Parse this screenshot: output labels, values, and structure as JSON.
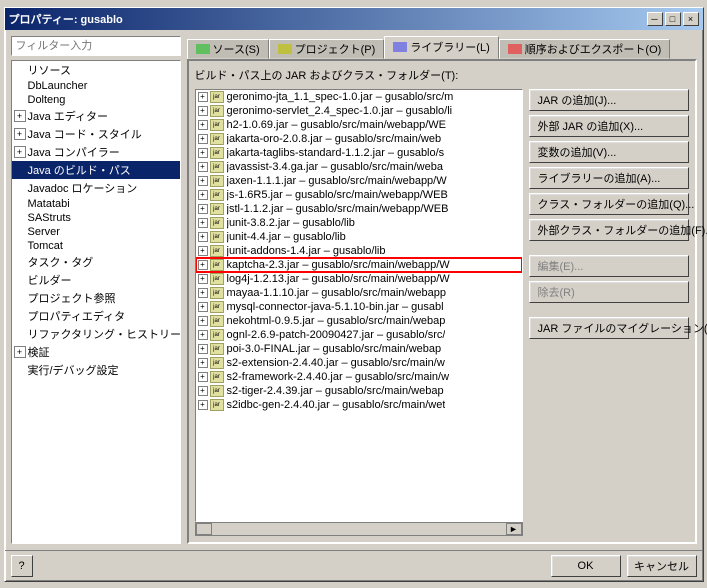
{
  "dialog": {
    "title": "プロパティー: gusablo",
    "close_btn": "×",
    "min_btn": "─",
    "max_btn": "□"
  },
  "left_panel": {
    "filter_placeholder": "フィルター入力",
    "tree_items": [
      {
        "id": "resources",
        "label": "リソース",
        "indent": 0,
        "expandable": false,
        "selected": false
      },
      {
        "id": "dblauncher",
        "label": "DbLauncher",
        "indent": 0,
        "expandable": false,
        "selected": false
      },
      {
        "id": "dolteng",
        "label": "Dolteng",
        "indent": 0,
        "expandable": false,
        "selected": false
      },
      {
        "id": "java-editor",
        "label": "Java エディター",
        "indent": 0,
        "expandable": true,
        "selected": false
      },
      {
        "id": "java-code-style",
        "label": "Java コード・スタイル",
        "indent": 0,
        "expandable": true,
        "selected": false
      },
      {
        "id": "java-compiler",
        "label": "Java コンパイラー",
        "indent": 0,
        "expandable": true,
        "selected": false
      },
      {
        "id": "java-build-path",
        "label": "Java のビルド・パス",
        "indent": 0,
        "expandable": false,
        "selected": true
      },
      {
        "id": "javadoc",
        "label": "Javadoc ロケーション",
        "indent": 0,
        "expandable": false,
        "selected": false
      },
      {
        "id": "matatabi",
        "label": "Matatabi",
        "indent": 0,
        "expandable": false,
        "selected": false
      },
      {
        "id": "sastruts",
        "label": "SAStruts",
        "indent": 0,
        "expandable": false,
        "selected": false
      },
      {
        "id": "server",
        "label": "Server",
        "indent": 0,
        "expandable": false,
        "selected": false
      },
      {
        "id": "tomcat",
        "label": "Tomcat",
        "indent": 0,
        "expandable": false,
        "selected": false
      },
      {
        "id": "task-tag",
        "label": "タスク・タグ",
        "indent": 0,
        "expandable": false,
        "selected": false
      },
      {
        "id": "builder",
        "label": "ビルダー",
        "indent": 0,
        "expandable": false,
        "selected": false
      },
      {
        "id": "project-ref",
        "label": "プロジェクト参照",
        "indent": 0,
        "expandable": false,
        "selected": false
      },
      {
        "id": "property-editor",
        "label": "プロパティエディタ",
        "indent": 0,
        "expandable": false,
        "selected": false
      },
      {
        "id": "refactoring",
        "label": "リファクタリング・ヒストリー",
        "indent": 0,
        "expandable": false,
        "selected": false
      },
      {
        "id": "test",
        "label": "検証",
        "indent": 0,
        "expandable": true,
        "selected": false
      },
      {
        "id": "run-debug",
        "label": "実行/デバッグ設定",
        "indent": 0,
        "expandable": false,
        "selected": false
      }
    ]
  },
  "tabs": [
    {
      "id": "source",
      "label": "ソース(S)",
      "active": false
    },
    {
      "id": "project",
      "label": "プロジェクト(P)",
      "active": false
    },
    {
      "id": "libraries",
      "label": "ライブラリー(L)",
      "active": true
    },
    {
      "id": "order",
      "label": "順序およびエクスポート(O)",
      "active": false
    }
  ],
  "main": {
    "panel_label": "ビルド・パス上の JAR およびクラス・フォルダー(T):",
    "jar_items": [
      {
        "id": "jar1",
        "label": "geronimo-jta_1.1_spec-1.0.jar – gusablo/src/m",
        "highlighted": false
      },
      {
        "id": "jar2",
        "label": "geronimo-servlet_2.4_spec-1.0.jar – gusablo/li",
        "highlighted": false
      },
      {
        "id": "jar3",
        "label": "h2-1.0.69.jar – gusablo/src/main/webapp/WE",
        "highlighted": false
      },
      {
        "id": "jar4",
        "label": "jakarta-oro-2.0.8.jar – gusablo/src/main/web",
        "highlighted": false
      },
      {
        "id": "jar5",
        "label": "jakarta-taglibs-standard-1.1.2.jar – gusablo/s",
        "highlighted": false
      },
      {
        "id": "jar6",
        "label": "javassist-3.4.ga.jar – gusablo/src/main/weba",
        "highlighted": false
      },
      {
        "id": "jar7",
        "label": "jaxen-1.1.1.jar – gusablo/src/main/webapp/W",
        "highlighted": false
      },
      {
        "id": "jar8",
        "label": "js-1.6R5.jar – gusablo/src/main/webapp/WEB",
        "highlighted": false
      },
      {
        "id": "jar9",
        "label": "jstl-1.1.2.jar – gusablo/src/main/webapp/WEB",
        "highlighted": false
      },
      {
        "id": "jar10",
        "label": "junit-3.8.2.jar – gusablo/lib",
        "highlighted": false
      },
      {
        "id": "jar11",
        "label": "junit-4.4.jar – gusablo/lib",
        "highlighted": false
      },
      {
        "id": "jar12",
        "label": "junit-addons-1.4.jar – gusablo/lib",
        "highlighted": false
      },
      {
        "id": "jar13",
        "label": "kaptcha-2.3.jar – gusablo/src/main/webapp/W",
        "highlighted": true
      },
      {
        "id": "jar14",
        "label": "log4j-1.2.13.jar – gusablo/src/main/webapp/W",
        "highlighted": false
      },
      {
        "id": "jar15",
        "label": "mayaa-1.1.10.jar – gusablo/src/main/webapp",
        "highlighted": false
      },
      {
        "id": "jar16",
        "label": "mysql-connector-java-5.1.10-bin.jar – gusabl",
        "highlighted": false
      },
      {
        "id": "jar17",
        "label": "nekohtml-0.9.5.jar – gusablo/src/main/webap",
        "highlighted": false
      },
      {
        "id": "jar18",
        "label": "ognl-2.6.9-patch-20090427.jar – gusablo/src/",
        "highlighted": false
      },
      {
        "id": "jar19",
        "label": "poi-3.0-FINAL.jar – gusablo/src/main/webap",
        "highlighted": false
      },
      {
        "id": "jar20",
        "label": "s2-extension-2.4.40.jar – gusablo/src/main/w",
        "highlighted": false
      },
      {
        "id": "jar21",
        "label": "s2-framework-2.4.40.jar – gusablo/src/main/w",
        "highlighted": false
      },
      {
        "id": "jar22",
        "label": "s2-tiger-2.4.39.jar – gusablo/src/main/webap",
        "highlighted": false
      },
      {
        "id": "jar23",
        "label": "s2idbc-gen-2.4.40.jar – gusablo/src/main/wet",
        "highlighted": false
      }
    ]
  },
  "buttons": {
    "add_jar": "JAR の追加(J)...",
    "add_external_jar": "外部 JAR の追加(X)...",
    "add_variable": "変数の追加(V)...",
    "add_library": "ライブラリーの追加(A)...",
    "add_class_folder": "クラス・フォルダーの追加(Q)...",
    "add_external_class_folder": "外部クラス・フォルダーの追加(F)...",
    "edit": "編集(E)...",
    "remove": "除去(R)",
    "migrate": "JAR ファイルのマイグレーション(M)..."
  },
  "bottom": {
    "help_label": "?",
    "ok_label": "OK",
    "cancel_label": "キャンセル"
  },
  "nav": {
    "back": "◄",
    "forward": "►",
    "menu": "▼"
  }
}
